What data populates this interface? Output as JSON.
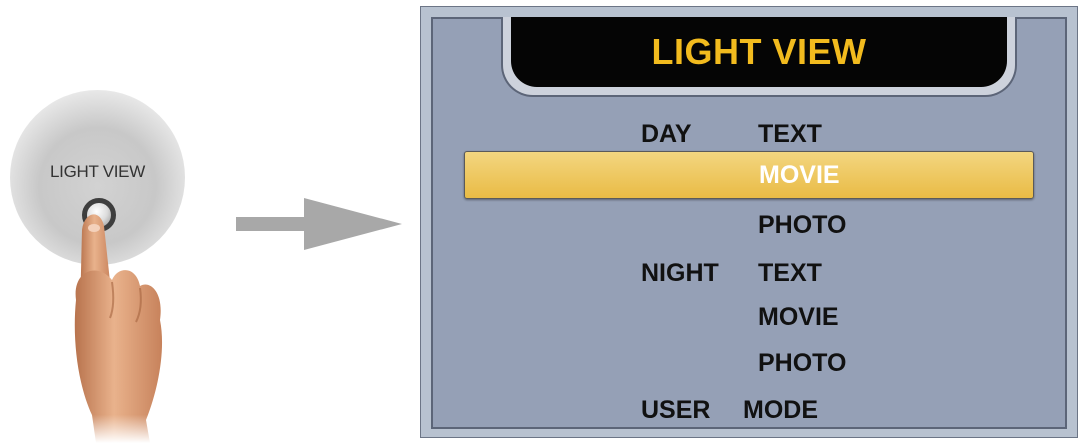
{
  "remote": {
    "button_label": "LIGHT VIEW"
  },
  "osd": {
    "title": "LIGHT VIEW",
    "rows": [
      {
        "group": "DAY",
        "option": "TEXT",
        "selected": false
      },
      {
        "group": "",
        "option": "MOVIE",
        "selected": true
      },
      {
        "group": "",
        "option": "PHOTO",
        "selected": false
      },
      {
        "group": "NIGHT",
        "option": "TEXT",
        "selected": false
      },
      {
        "group": "",
        "option": "MOVIE",
        "selected": false
      },
      {
        "group": "",
        "option": "PHOTO",
        "selected": false
      },
      {
        "group": "USER",
        "option": "MODE",
        "selected": false
      }
    ]
  },
  "colors": {
    "title": "#f2bb1e",
    "highlight": "#eec75a",
    "panel": "#95a0b6",
    "selected_text": "#ffffff"
  },
  "icons": {
    "arrow": "right-arrow-icon",
    "hand": "pointing-finger-icon"
  }
}
